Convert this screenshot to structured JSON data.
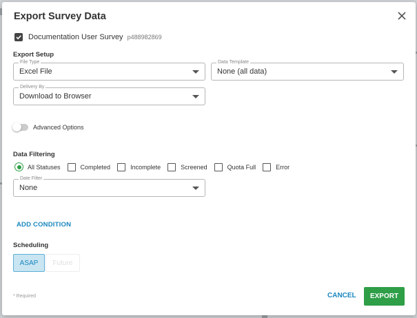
{
  "dialog": {
    "title": "Export Survey Data",
    "close_icon": "close-icon"
  },
  "survey": {
    "name": "Documentation User Survey",
    "id": "p488982869",
    "checked": true
  },
  "export_setup": {
    "heading": "Export Setup",
    "file_type": {
      "label": "File Type",
      "value": "Excel File"
    },
    "data_template": {
      "label": "Data Template",
      "value": "None (all data)"
    },
    "delivery_by": {
      "label": "Delivery By",
      "value": "Download to Browser"
    }
  },
  "advanced_options": {
    "label": "Advanced Options",
    "enabled": false
  },
  "data_filtering": {
    "heading": "Data Filtering",
    "statuses": [
      {
        "label": "All Statuses",
        "type": "radio",
        "selected": true
      },
      {
        "label": "Completed",
        "type": "checkbox",
        "checked": false
      },
      {
        "label": "Incomplete",
        "type": "checkbox",
        "checked": false
      },
      {
        "label": "Screened",
        "type": "checkbox",
        "checked": false
      },
      {
        "label": "Quota Full",
        "type": "checkbox",
        "checked": false
      },
      {
        "label": "Error",
        "type": "checkbox",
        "checked": false
      }
    ],
    "date_filter": {
      "label": "Date Filter",
      "value": "None"
    },
    "add_condition": "ADD CONDITION"
  },
  "scheduling": {
    "heading": "Scheduling",
    "asap": "ASAP",
    "future": "Future"
  },
  "footer": {
    "required_note": "* Required",
    "cancel": "CANCEL",
    "export": "EXPORT"
  },
  "colors": {
    "accent": "#1a86bf",
    "primary": "#2e9e47"
  }
}
